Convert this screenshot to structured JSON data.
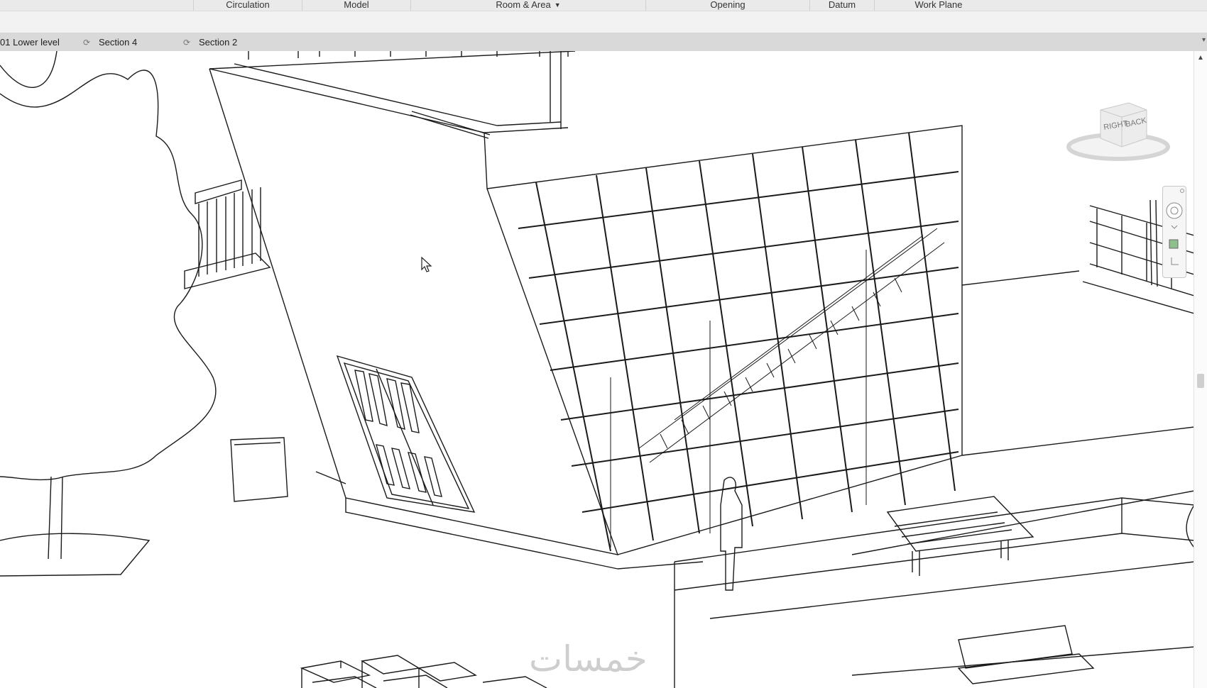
{
  "ribbon": {
    "panels": [
      {
        "label": "Circulation",
        "dropdown": false
      },
      {
        "label": "Model",
        "dropdown": false
      },
      {
        "label": "Room & Area",
        "dropdown": true
      },
      {
        "label": "Opening",
        "dropdown": false
      },
      {
        "label": "Datum",
        "dropdown": false
      },
      {
        "label": "Work Plane",
        "dropdown": false
      }
    ]
  },
  "view_tabs": {
    "items": [
      {
        "label": "01 Lower level",
        "icon": "floor-plan-icon"
      },
      {
        "label": "Section 4",
        "icon": "section-view-icon"
      },
      {
        "label": "Section 2",
        "icon": "section-view-icon"
      }
    ]
  },
  "viewcube": {
    "faces": [
      "RIGHT",
      "BACK"
    ]
  },
  "watermark": {
    "text": "خمسات"
  },
  "colors": {
    "ribbon_bg": "#f2f2f2",
    "tabs_bg": "#d9d9d9",
    "canvas_bg": "#ffffff",
    "line": "#1a1a1a"
  }
}
